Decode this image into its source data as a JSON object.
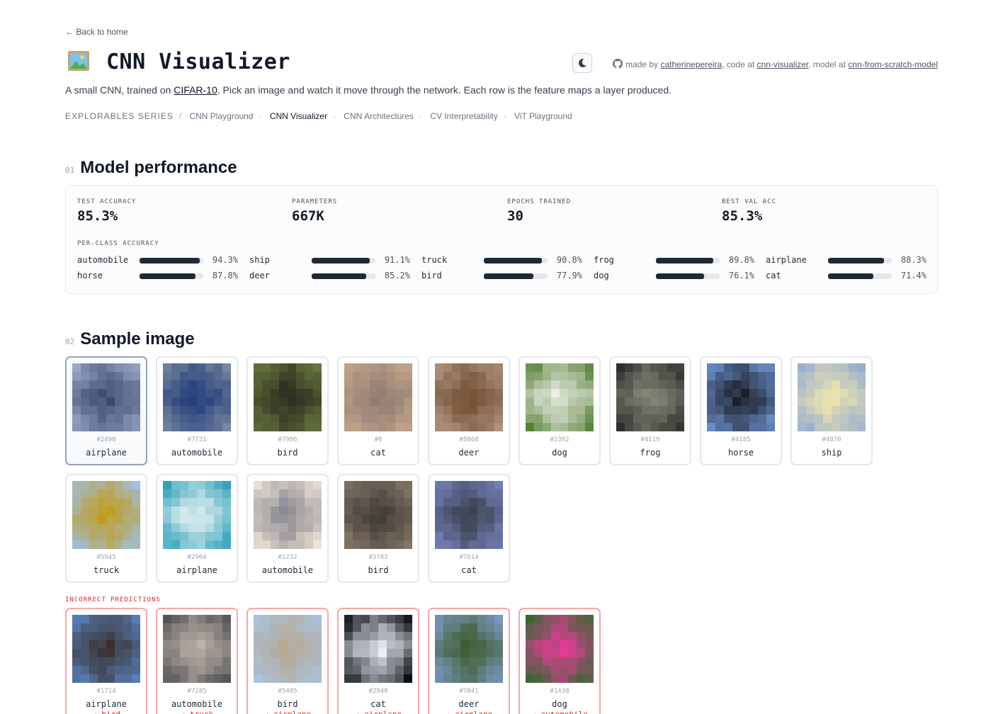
{
  "nav": {
    "back_label": "← Back to home"
  },
  "header": {
    "title": "CNN Visualizer",
    "title_icon": "framed-picture-icon",
    "credits": {
      "made_by_prefix": "made by",
      "author": "catherinepereira",
      "code_prefix": ", code at",
      "code_link": "cnn-visualizer",
      "model_prefix": ", model at",
      "model_link": "cnn-from-scratch-model"
    }
  },
  "subtitle": {
    "before": "A small CNN, trained on ",
    "link": "CIFAR-10",
    "after": ". Pick an image and watch it move through the network. Each row is the feature maps a layer produced."
  },
  "series": {
    "label": "EXPLORABLES SERIES",
    "items": [
      {
        "label": "CNN Playground",
        "active": false
      },
      {
        "label": "CNN Visualizer",
        "active": true
      },
      {
        "label": "CNN Architectures",
        "active": false
      },
      {
        "label": "CV Interpretability",
        "active": false
      },
      {
        "label": "ViT Playground",
        "active": false
      }
    ]
  },
  "performance": {
    "num": "01",
    "title": "Model performance",
    "stats": [
      {
        "label": "TEST ACCURACY",
        "value": "85.3%"
      },
      {
        "label": "PARAMETERS",
        "value": "667K"
      },
      {
        "label": "EPOCHS TRAINED",
        "value": "30"
      },
      {
        "label": "BEST VAL ACC",
        "value": "85.3%"
      }
    ],
    "per_class_label": "PER-CLASS ACCURACY",
    "per_class": [
      {
        "name": "automobile",
        "value": 94.3,
        "text": "94.3%"
      },
      {
        "name": "ship",
        "value": 91.1,
        "text": "91.1%"
      },
      {
        "name": "truck",
        "value": 90.8,
        "text": "90.8%"
      },
      {
        "name": "frog",
        "value": 89.8,
        "text": "89.8%"
      },
      {
        "name": "airplane",
        "value": 88.3,
        "text": "88.3%"
      },
      {
        "name": "horse",
        "value": 87.8,
        "text": "87.8%"
      },
      {
        "name": "deer",
        "value": 85.2,
        "text": "85.2%"
      },
      {
        "name": "bird",
        "value": 77.9,
        "text": "77.9%"
      },
      {
        "name": "dog",
        "value": 76.1,
        "text": "76.1%"
      },
      {
        "name": "cat",
        "value": 71.4,
        "text": "71.4%"
      }
    ]
  },
  "samples": {
    "num": "02",
    "title": "Sample image",
    "selected_id": "#2490",
    "correct": [
      {
        "id": "#2490",
        "label": "airplane",
        "colors": [
          "#9aa7c7",
          "#3d4a6e"
        ]
      },
      {
        "id": "#7731",
        "label": "automobile",
        "colors": [
          "#7a8aa0",
          "#1f3a7a"
        ]
      },
      {
        "id": "#7906",
        "label": "bird",
        "colors": [
          "#6b7a3f",
          "#2a2a1e"
        ]
      },
      {
        "id": "#8",
        "label": "cat",
        "colors": [
          "#c6a98a",
          "#8d7a72"
        ]
      },
      {
        "id": "#8868",
        "label": "deer",
        "colors": [
          "#b49a82",
          "#6e4a2e"
        ]
      },
      {
        "id": "#2392",
        "label": "dog",
        "colors": [
          "#4b7a2a",
          "#f2f2ee"
        ]
      },
      {
        "id": "#4119",
        "label": "frog",
        "colors": [
          "#2b2b2b",
          "#8a8a7a"
        ]
      },
      {
        "id": "#4185",
        "label": "horse",
        "colors": [
          "#6f9ad8",
          "#1d1f2a"
        ]
      },
      {
        "id": "#4870",
        "label": "ship",
        "colors": [
          "#8fa8d8",
          "#f0e7a8"
        ]
      },
      {
        "id": "#5945",
        "label": "truck",
        "colors": [
          "#9cc2e8",
          "#c49a1a"
        ]
      },
      {
        "id": "#2964",
        "label": "airplane",
        "colors": [
          "#2aa0b8",
          "#e8f2f4"
        ]
      },
      {
        "id": "#1232",
        "label": "automobile",
        "colors": [
          "#f2e6d8",
          "#8a8a92"
        ]
      },
      {
        "id": "#3783",
        "label": "bird",
        "colors": [
          "#8a7a6a",
          "#3e3a36"
        ]
      },
      {
        "id": "#7014",
        "label": "cat",
        "colors": [
          "#7a8ac8",
          "#3a3e4a"
        ]
      }
    ],
    "incorrect_label": "INCORRECT PREDICTIONS",
    "incorrect": [
      {
        "id": "#1714",
        "label": "airplane",
        "pred": "→ bird",
        "colors": [
          "#5a86c8",
          "#3a2e2a"
        ]
      },
      {
        "id": "#7285",
        "label": "automobile",
        "pred": "→ truck",
        "colors": [
          "#4a4a4e",
          "#c2b8ae"
        ]
      },
      {
        "id": "#5405",
        "label": "bird",
        "pred": "→ airplane",
        "colors": [
          "#a8c4e6",
          "#b8a88e"
        ]
      },
      {
        "id": "#2940",
        "label": "cat",
        "pred": "→ airplane",
        "colors": [
          "#05080e",
          "#e8eef6"
        ]
      },
      {
        "id": "#7041",
        "label": "deer",
        "pred": "→ airplane",
        "colors": [
          "#7a9ac4",
          "#3e5a2a"
        ]
      },
      {
        "id": "#1438",
        "label": "dog",
        "pred": "→ automobile",
        "colors": [
          "#2f6a2e",
          "#e83a9a"
        ]
      }
    ]
  }
}
